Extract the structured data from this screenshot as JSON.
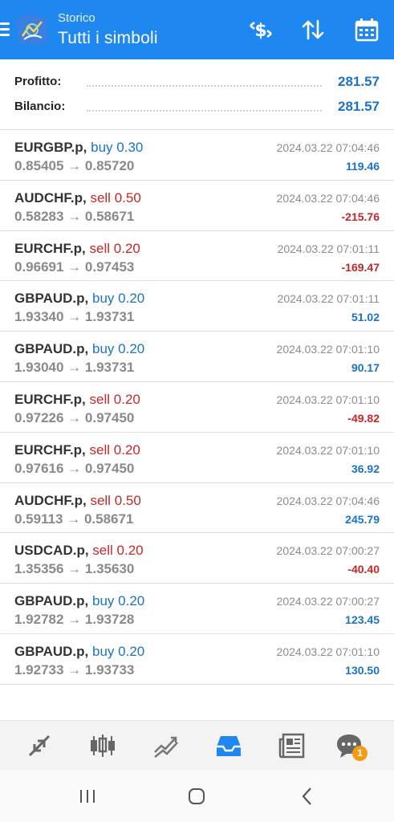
{
  "header": {
    "subtitle": "Storico",
    "title": "Tutti i simboli"
  },
  "summary": {
    "profit_label": "Profitto:",
    "profit_value": "281.57",
    "balance_label": "Bilancio:",
    "balance_value": "281.57"
  },
  "trades": [
    {
      "symbol": "EURGBP.p,",
      "direction": "buy",
      "volume": "0.30",
      "open": "0.85405",
      "close": "0.85720",
      "time": "2024.03.22 07:04:46",
      "profit": "119.46"
    },
    {
      "symbol": "AUDCHF.p,",
      "direction": "sell",
      "volume": "0.50",
      "open": "0.58283",
      "close": "0.58671",
      "time": "2024.03.22 07:04:46",
      "profit": "-215.76"
    },
    {
      "symbol": "EURCHF.p,",
      "direction": "sell",
      "volume": "0.20",
      "open": "0.96691",
      "close": "0.97453",
      "time": "2024.03.22 07:01:11",
      "profit": "-169.47"
    },
    {
      "symbol": "GBPAUD.p,",
      "direction": "buy",
      "volume": "0.20",
      "open": "1.93340",
      "close": "1.93731",
      "time": "2024.03.22 07:01:11",
      "profit": "51.02"
    },
    {
      "symbol": "GBPAUD.p,",
      "direction": "buy",
      "volume": "0.20",
      "open": "1.93040",
      "close": "1.93731",
      "time": "2024.03.22 07:01:10",
      "profit": "90.17"
    },
    {
      "symbol": "EURCHF.p,",
      "direction": "sell",
      "volume": "0.20",
      "open": "0.97226",
      "close": "0.97450",
      "time": "2024.03.22 07:01:10",
      "profit": "-49.82"
    },
    {
      "symbol": "EURCHF.p,",
      "direction": "sell",
      "volume": "0.20",
      "open": "0.97616",
      "close": "0.97450",
      "time": "2024.03.22 07:01:10",
      "profit": "36.92"
    },
    {
      "symbol": "AUDCHF.p,",
      "direction": "sell",
      "volume": "0.50",
      "open": "0.59113",
      "close": "0.58671",
      "time": "2024.03.22 07:04:46",
      "profit": "245.79"
    },
    {
      "symbol": "USDCAD.p,",
      "direction": "sell",
      "volume": "0.20",
      "open": "1.35356",
      "close": "1.35630",
      "time": "2024.03.22 07:00:27",
      "profit": "-40.40"
    },
    {
      "symbol": "GBPAUD.p,",
      "direction": "buy",
      "volume": "0.20",
      "open": "1.92782",
      "close": "1.93728",
      "time": "2024.03.22 07:00:27",
      "profit": "123.45"
    },
    {
      "symbol": "GBPAUD.p,",
      "direction": "buy",
      "volume": "0.20",
      "open": "1.92733",
      "close": "1.93733",
      "time": "2024.03.22 07:01:10",
      "profit": "130.50"
    }
  ],
  "toolbar": {
    "items": [
      "quotes-icon",
      "chart-icon",
      "trade-icon",
      "history-icon",
      "news-icon",
      "chat-icon"
    ],
    "active": "history-icon",
    "chat_badge": "1"
  },
  "colors": {
    "header": "#1e88f0",
    "buy": "#1a73c8",
    "sell": "#c62828",
    "badge": "#f39c12"
  }
}
